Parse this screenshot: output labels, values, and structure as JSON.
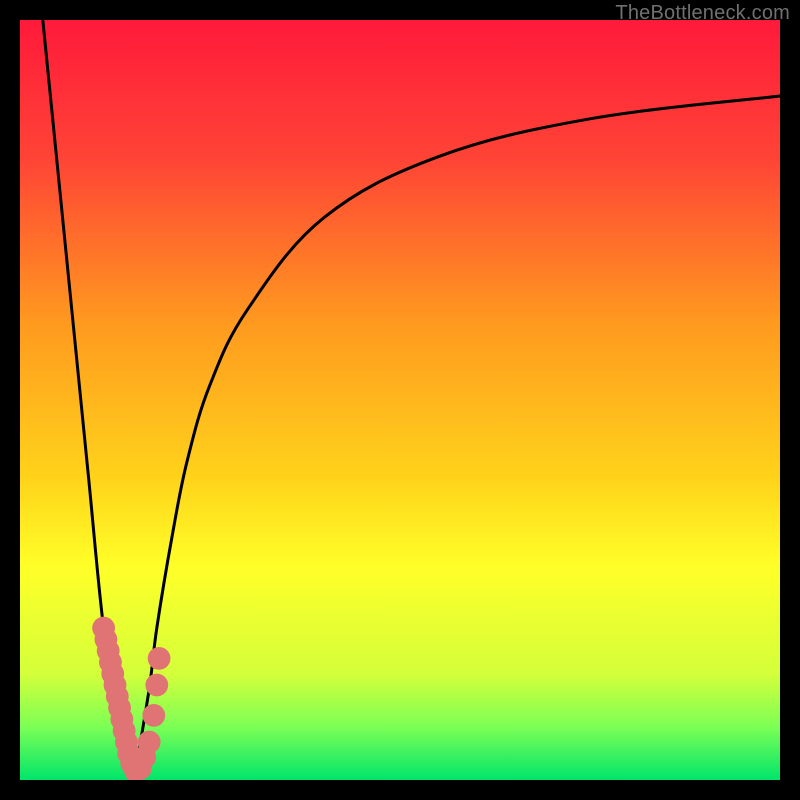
{
  "watermark": "TheBottleneck.com",
  "chart_data": {
    "type": "line",
    "title": "",
    "xlabel": "",
    "ylabel": "",
    "xlim": [
      0,
      100
    ],
    "ylim": [
      0,
      100
    ],
    "grid": false,
    "gradient_stops": [
      {
        "pos": 0.0,
        "color": "#ff1a3a"
      },
      {
        "pos": 0.18,
        "color": "#ff4336"
      },
      {
        "pos": 0.4,
        "color": "#ff9a1f"
      },
      {
        "pos": 0.6,
        "color": "#ffd21a"
      },
      {
        "pos": 0.72,
        "color": "#ffff28"
      },
      {
        "pos": 0.86,
        "color": "#d4ff3a"
      },
      {
        "pos": 0.93,
        "color": "#7cff55"
      },
      {
        "pos": 1.0,
        "color": "#00e56a"
      }
    ],
    "series": [
      {
        "name": "curve-left",
        "x": [
          3,
          5,
          7,
          9,
          11,
          13,
          15
        ],
        "y": [
          100,
          80,
          60,
          40,
          20,
          8,
          0
        ]
      },
      {
        "name": "curve-right",
        "x": [
          15,
          17,
          18,
          20,
          22,
          25,
          30,
          40,
          55,
          75,
          100
        ],
        "y": [
          0,
          12,
          20,
          32,
          42,
          52,
          62,
          74,
          82,
          87,
          90
        ]
      }
    ],
    "markers": {
      "name": "dotted-v",
      "color": "#e07373",
      "radius": 1.5,
      "points": [
        {
          "x": 11.0,
          "y": 20.0
        },
        {
          "x": 11.3,
          "y": 18.5
        },
        {
          "x": 11.6,
          "y": 17.0
        },
        {
          "x": 11.9,
          "y": 15.5
        },
        {
          "x": 12.2,
          "y": 14.0
        },
        {
          "x": 12.5,
          "y": 12.5
        },
        {
          "x": 12.8,
          "y": 11.0
        },
        {
          "x": 13.1,
          "y": 9.5
        },
        {
          "x": 13.4,
          "y": 8.0
        },
        {
          "x": 13.7,
          "y": 6.5
        },
        {
          "x": 14.0,
          "y": 5.0
        },
        {
          "x": 14.3,
          "y": 3.5
        },
        {
          "x": 14.7,
          "y": 2.2
        },
        {
          "x": 15.2,
          "y": 1.2
        },
        {
          "x": 15.8,
          "y": 1.5
        },
        {
          "x": 16.4,
          "y": 3.0
        },
        {
          "x": 17.0,
          "y": 5.0
        },
        {
          "x": 17.6,
          "y": 8.5
        },
        {
          "x": 18.0,
          "y": 12.5
        },
        {
          "x": 18.3,
          "y": 16.0
        }
      ]
    }
  }
}
